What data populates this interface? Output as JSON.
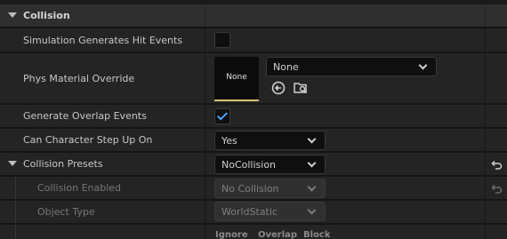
{
  "section": {
    "title": "Collision"
  },
  "rows": {
    "sim_hit": {
      "label": "Simulation Generates Hit Events",
      "checked": false
    },
    "phys_mat": {
      "label": "Phys Material Override",
      "thumb_text": "None",
      "combo_value": "None"
    },
    "overlap": {
      "label": "Generate Overlap Events",
      "checked": true
    },
    "step_up": {
      "label": "Can Character Step Up On",
      "value": "Yes"
    },
    "presets": {
      "label": "Collision Presets",
      "value": "NoCollision"
    },
    "enabled": {
      "label": "Collision Enabled",
      "value": "No Collision"
    },
    "object_type": {
      "label": "Object Type",
      "value": "WorldStatic"
    }
  },
  "responses": {
    "ignore": "Ignore",
    "overlap": "Overlap",
    "block": "Block"
  },
  "colors": {
    "accent": "#4aa1ff",
    "thumb_underline": "#d9c37a"
  },
  "icons": [
    "chevron-down-icon",
    "arrow-left-circle-icon",
    "browse-asset-icon",
    "reset-arrow-icon",
    "checkmark-icon"
  ]
}
